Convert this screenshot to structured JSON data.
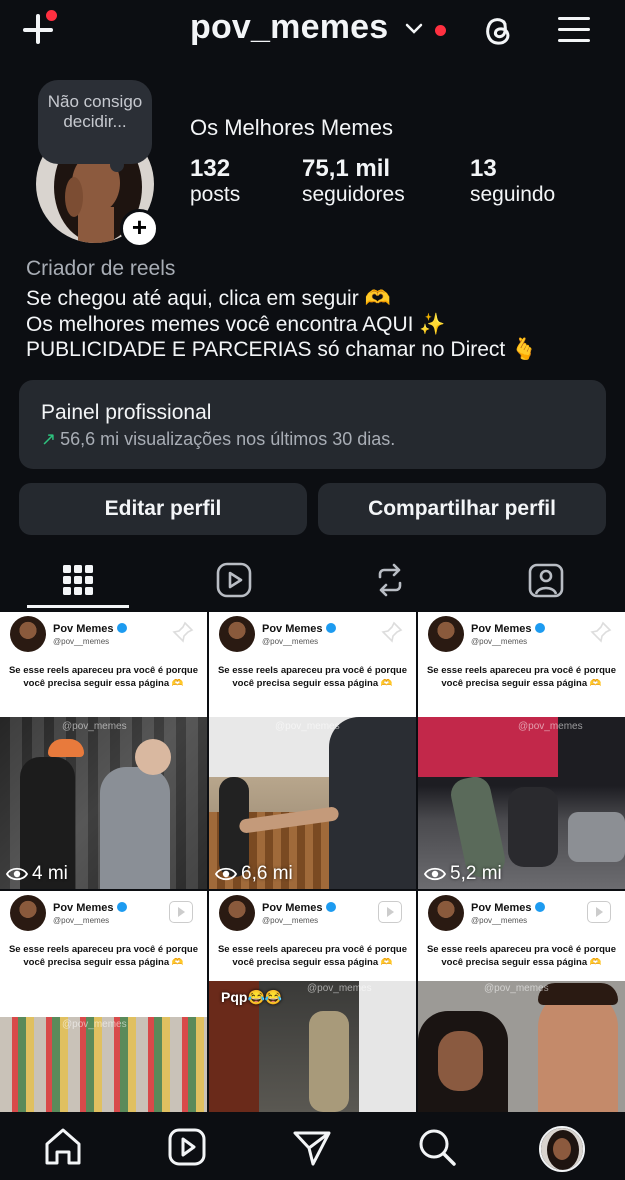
{
  "header": {
    "username": "pov_memes"
  },
  "profile": {
    "note": "Não consigo decidir...",
    "display_name": "Os Melhores Memes",
    "stats": [
      {
        "value": "132",
        "label": "posts"
      },
      {
        "value": "75,1 mil",
        "label": "seguidores"
      },
      {
        "value": "13",
        "label": "seguindo"
      }
    ],
    "category": "Criador de reels",
    "bio_lines": [
      "Se chegou até aqui, clica em seguir 🫶",
      "Os melhores memes você encontra AQUI ✨",
      "PUBLICIDADE E PARCERIAS só chamar no Direct 🫰"
    ]
  },
  "dashboard": {
    "title": "Painel profissional",
    "subtitle": "56,6 mi visualizações nos últimos 30 dias."
  },
  "buttons": {
    "edit": "Editar perfil",
    "share": "Compartilhar perfil"
  },
  "tabs": [
    "grid-icon",
    "reels-icon",
    "reposts-icon",
    "tagged-icon"
  ],
  "posts": [
    {
      "name": "Pov Memes",
      "handle": "@pov__memes",
      "text": "Se esse reels apareceu pra você é porque você precisa seguir essa página 🫶",
      "views": "4 mi",
      "pinned": true,
      "watermark": "@pov_memes"
    },
    {
      "name": "Pov Memes",
      "handle": "@pov__memes",
      "text": "Se esse reels apareceu pra você é porque você precisa seguir essa página 🫶",
      "views": "6,6 mi",
      "pinned": true,
      "watermark": "@pov_memes"
    },
    {
      "name": "Pov Memes",
      "handle": "@pov__memes",
      "text": "Se esse reels apareceu pra você é porque você precisa seguir essa página 🫶",
      "views": "5,2 mi",
      "pinned": true,
      "watermark": "@pov_memes"
    },
    {
      "name": "Pov Memes",
      "handle": "@pov__memes",
      "text": "Se esse reels apareceu pra você é porque você precisa seguir essa página 🫶",
      "views": "",
      "pinned": false,
      "watermark": "@pov_memes"
    },
    {
      "name": "Pov Memes",
      "handle": "@pov__memes",
      "text": "Se esse reels apareceu pra você é porque você precisa seguir essa página 🫶",
      "views": "",
      "pinned": false,
      "watermark": "@pov_memes",
      "overlay_text": "Pqp😂😂"
    },
    {
      "name": "Pov Memes",
      "handle": "@pov__memes",
      "text": "Se esse reels apareceu pra você é porque você precisa seguir essa página 🫶",
      "views": "",
      "pinned": false,
      "watermark": "@pov_memes"
    }
  ],
  "bottom_nav": [
    "home-icon",
    "reels-icon",
    "direct-icon",
    "search-icon",
    "profile-avatar"
  ],
  "colors": {
    "background": "#0c0e12",
    "card": "#25292f",
    "notification": "#ff3040",
    "trend": "#2ec27e"
  }
}
